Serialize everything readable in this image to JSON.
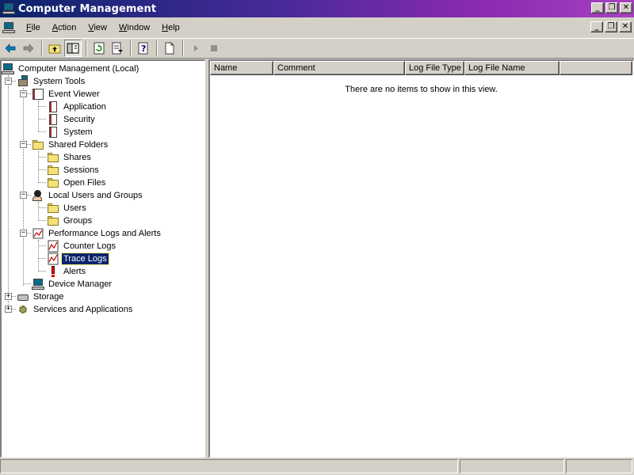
{
  "window": {
    "title": "Computer Management",
    "caption_buttons": {
      "minimize": "_",
      "maximize": "❐",
      "close": "✕"
    }
  },
  "menubar": {
    "items": [
      {
        "label": "File",
        "accel": "F",
        "rest": "ile"
      },
      {
        "label": "Action",
        "accel": "A",
        "rest": "ction"
      },
      {
        "label": "View",
        "accel": "V",
        "rest": "iew"
      },
      {
        "label": "Window",
        "accel": "W",
        "rest": "indow"
      },
      {
        "label": "Help",
        "accel": "H",
        "rest": "elp"
      }
    ]
  },
  "toolbar": {
    "buttons": [
      "back-arrow-icon",
      "forward-arrow-icon",
      "up-folder-icon",
      "show-hide-tree-icon",
      "refresh-icon",
      "export-list-icon",
      "help-icon",
      "new-document-icon",
      "start-icon",
      "stop-icon"
    ]
  },
  "tree": {
    "items": [
      {
        "label": "Computer Management (Local)",
        "icon": "computer-icon"
      },
      {
        "label": "System Tools",
        "icon": "tools-icon"
      },
      {
        "label": "Event Viewer",
        "icon": "event-viewer-icon"
      },
      {
        "label": "Application",
        "icon": "log-icon"
      },
      {
        "label": "Security",
        "icon": "log-icon"
      },
      {
        "label": "System",
        "icon": "log-icon"
      },
      {
        "label": "Shared Folders",
        "icon": "shared-folder-icon"
      },
      {
        "label": "Shares",
        "icon": "folder-icon"
      },
      {
        "label": "Sessions",
        "icon": "folder-icon"
      },
      {
        "label": "Open Files",
        "icon": "folder-icon"
      },
      {
        "label": "Local Users and Groups",
        "icon": "users-icon"
      },
      {
        "label": "Users",
        "icon": "folder-icon"
      },
      {
        "label": "Groups",
        "icon": "folder-icon"
      },
      {
        "label": "Performance Logs and Alerts",
        "icon": "performance-icon"
      },
      {
        "label": "Counter Logs",
        "icon": "chart-log-icon"
      },
      {
        "label": "Trace Logs",
        "icon": "chart-log-icon"
      },
      {
        "label": "Alerts",
        "icon": "alert-icon"
      },
      {
        "label": "Device Manager",
        "icon": "device-manager-icon"
      },
      {
        "label": "Storage",
        "icon": "storage-icon"
      },
      {
        "label": "Services and Applications",
        "icon": "services-icon"
      }
    ],
    "selected": "Trace Logs"
  },
  "list": {
    "columns": [
      "Name",
      "Comment",
      "Log File Type",
      "Log File Name"
    ],
    "empty_message": "There are no items to show in this view."
  },
  "colors": {
    "selection": "#0a246a",
    "face": "#d4d0c8"
  }
}
